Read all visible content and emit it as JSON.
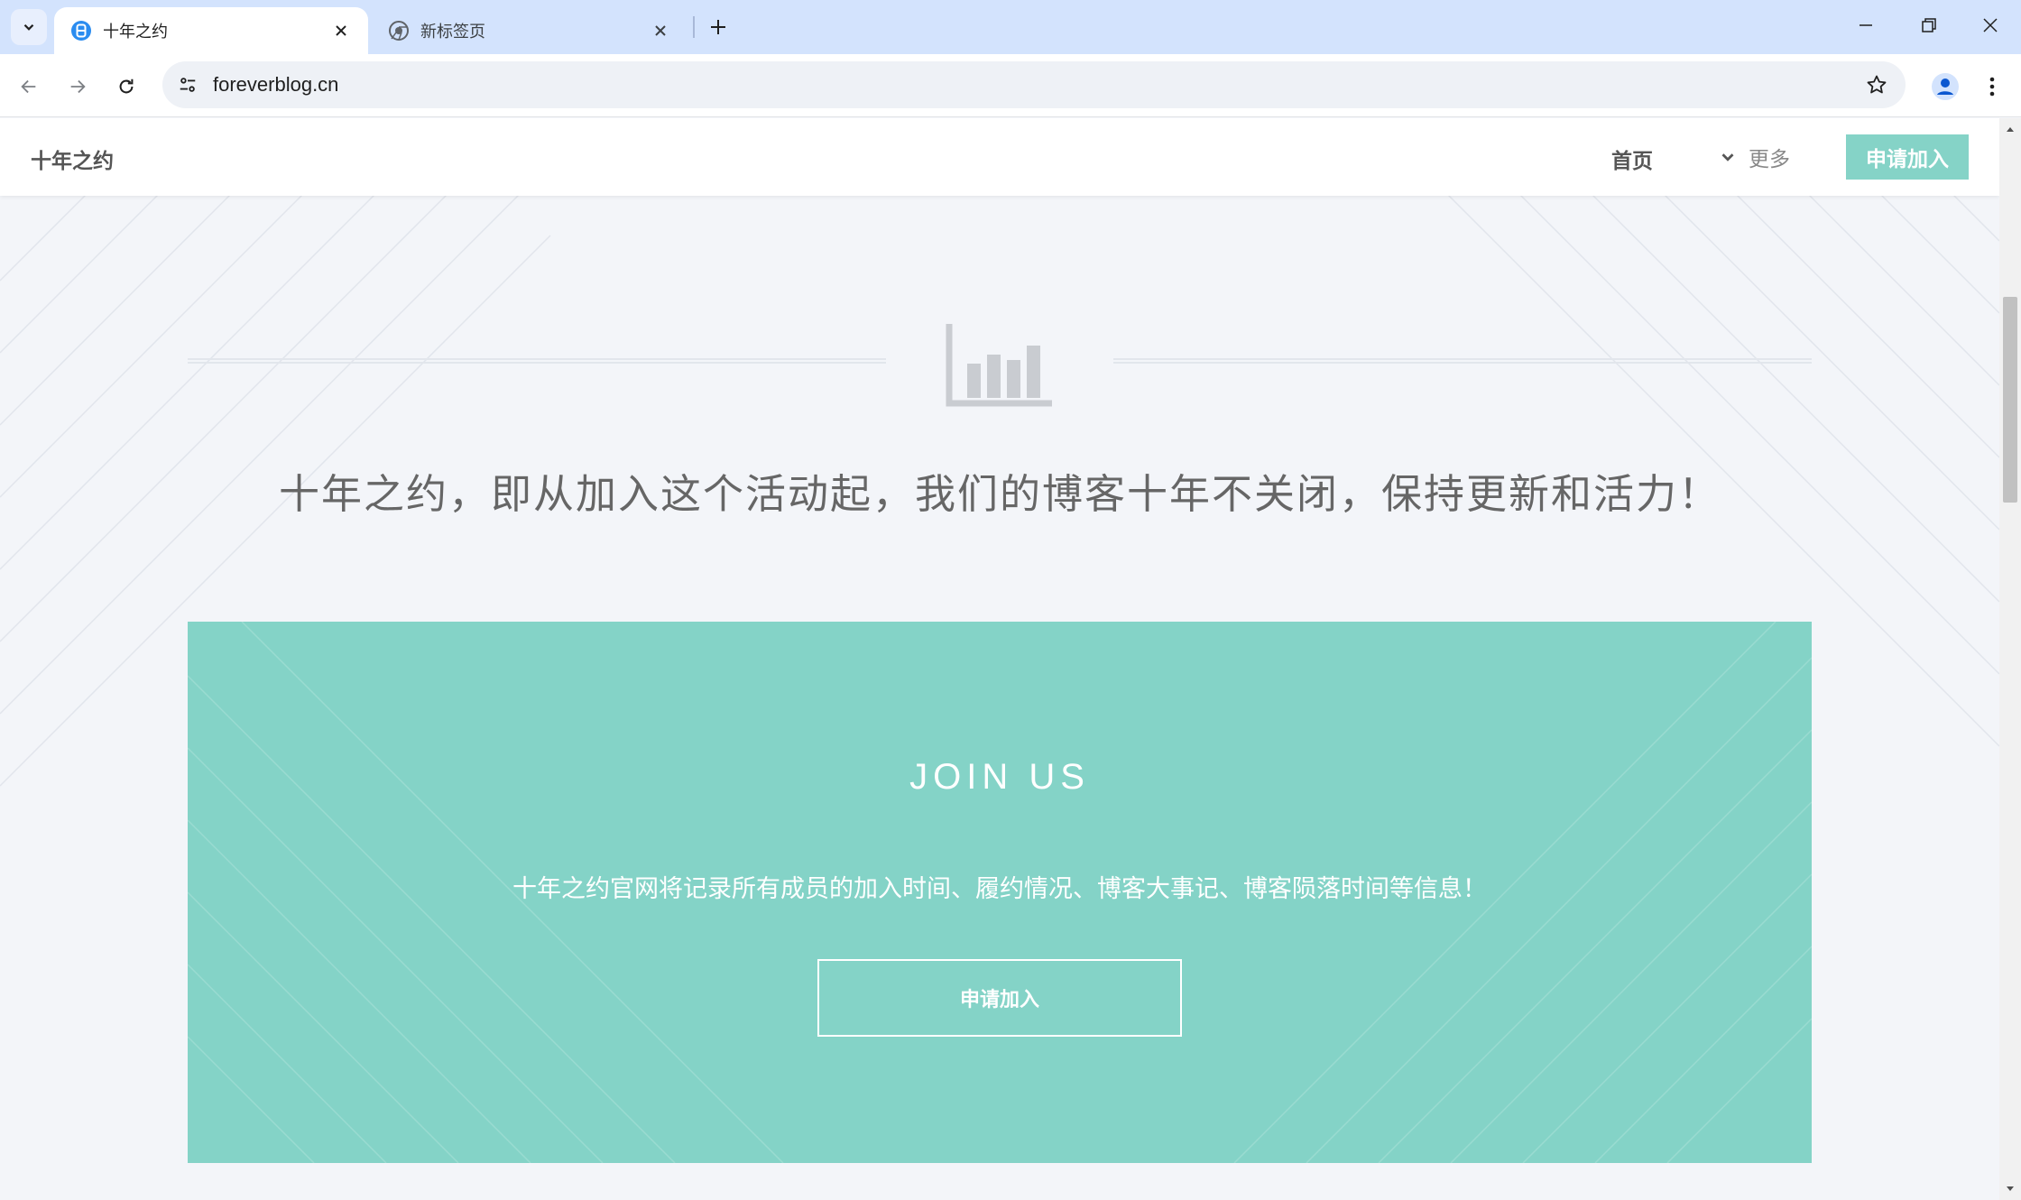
{
  "browser": {
    "tabs": [
      {
        "title": "十年之约",
        "active": true,
        "favicon": "blog-b-icon"
      },
      {
        "title": "新标签页",
        "active": false,
        "favicon": "chrome-icon"
      }
    ],
    "url": "foreverblog.cn"
  },
  "site": {
    "brand": "十年之约",
    "nav": {
      "home": "首页",
      "more": "更多",
      "join": "申请加入"
    },
    "tagline": "十年之约，即从加入这个活动起，我们的博客十年不关闭，保持更新和活力！",
    "join_section": {
      "title": "JOIN US",
      "description": "十年之约官网将记录所有成员的加入时间、履约情况、博客大事记、博客陨落时间等信息！",
      "button": "申请加入"
    }
  },
  "colors": {
    "accent": "#85d3c7",
    "tabbar": "#d3e3fd"
  }
}
